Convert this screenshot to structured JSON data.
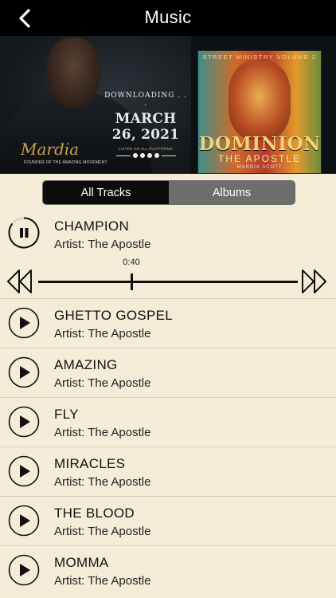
{
  "header": {
    "title": "Music"
  },
  "banner": {
    "signature": "Mardia",
    "founder": "FOUNDER OF THE AMAZING MOVEMENT",
    "downloading": "DOWNLOADING . . .",
    "date": "MARCH 26, 2021",
    "listen": "LISTEN ON ALL PLATFORMS",
    "album": {
      "subtitle": "STREET MINISTRY VOLUME 2",
      "title": "DOMINION",
      "artist": "THE APOSTLE",
      "credit": "MARDIA SCOTT"
    }
  },
  "tabs": {
    "all_tracks": "All Tracks",
    "albums": "Albums"
  },
  "now_playing": {
    "title": "CHAMPION",
    "artist": "Artist: The Apostle",
    "time": "0:40",
    "progress": 0.36
  },
  "tracks": [
    {
      "title": "GHETTO GOSPEL",
      "artist": "Artist: The Apostle"
    },
    {
      "title": "AMAZING",
      "artist": "Artist: The Apostle"
    },
    {
      "title": "FLY",
      "artist": "Artist: The Apostle"
    },
    {
      "title": "MIRACLES",
      "artist": "Artist: The Apostle"
    },
    {
      "title": "THE BLOOD",
      "artist": "Artist: The Apostle"
    },
    {
      "title": "MOMMA",
      "artist": "Artist: The Apostle"
    }
  ],
  "icons": {
    "back": "chevron-left-icon",
    "pause": "pause-icon",
    "play": "play-icon",
    "rewind": "rewind-icon",
    "fast_forward": "fast-forward-icon"
  },
  "colors": {
    "background": "#f4ecd7",
    "header": "#000000",
    "tab_active": "#0c0c0c",
    "tab_inactive": "#6d6d6b"
  }
}
